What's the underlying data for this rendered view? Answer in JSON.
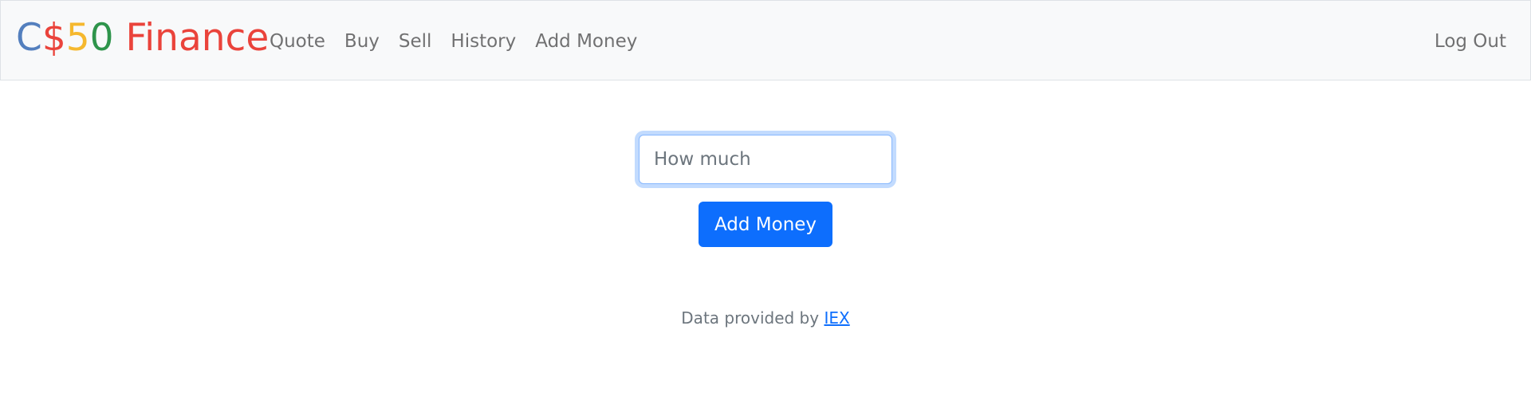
{
  "brand": {
    "parts": [
      "C",
      "$",
      "5",
      "0",
      " Finance"
    ],
    "colors": [
      "#537fbe",
      "#ea433b",
      "#f5b82e",
      "#2e944b",
      "#ea433b"
    ]
  },
  "nav": {
    "items": [
      {
        "label": "Quote"
      },
      {
        "label": "Buy"
      },
      {
        "label": "Sell"
      },
      {
        "label": "History"
      },
      {
        "label": "Add Money"
      }
    ],
    "logout_label": "Log Out"
  },
  "form": {
    "amount_placeholder": "How much",
    "amount_value": "",
    "submit_label": "Add Money"
  },
  "footer": {
    "text": "Data provided by ",
    "link_label": "IEX"
  },
  "colors": {
    "accent": "#0d6efd",
    "navbar_bg": "#f8f9fa"
  }
}
